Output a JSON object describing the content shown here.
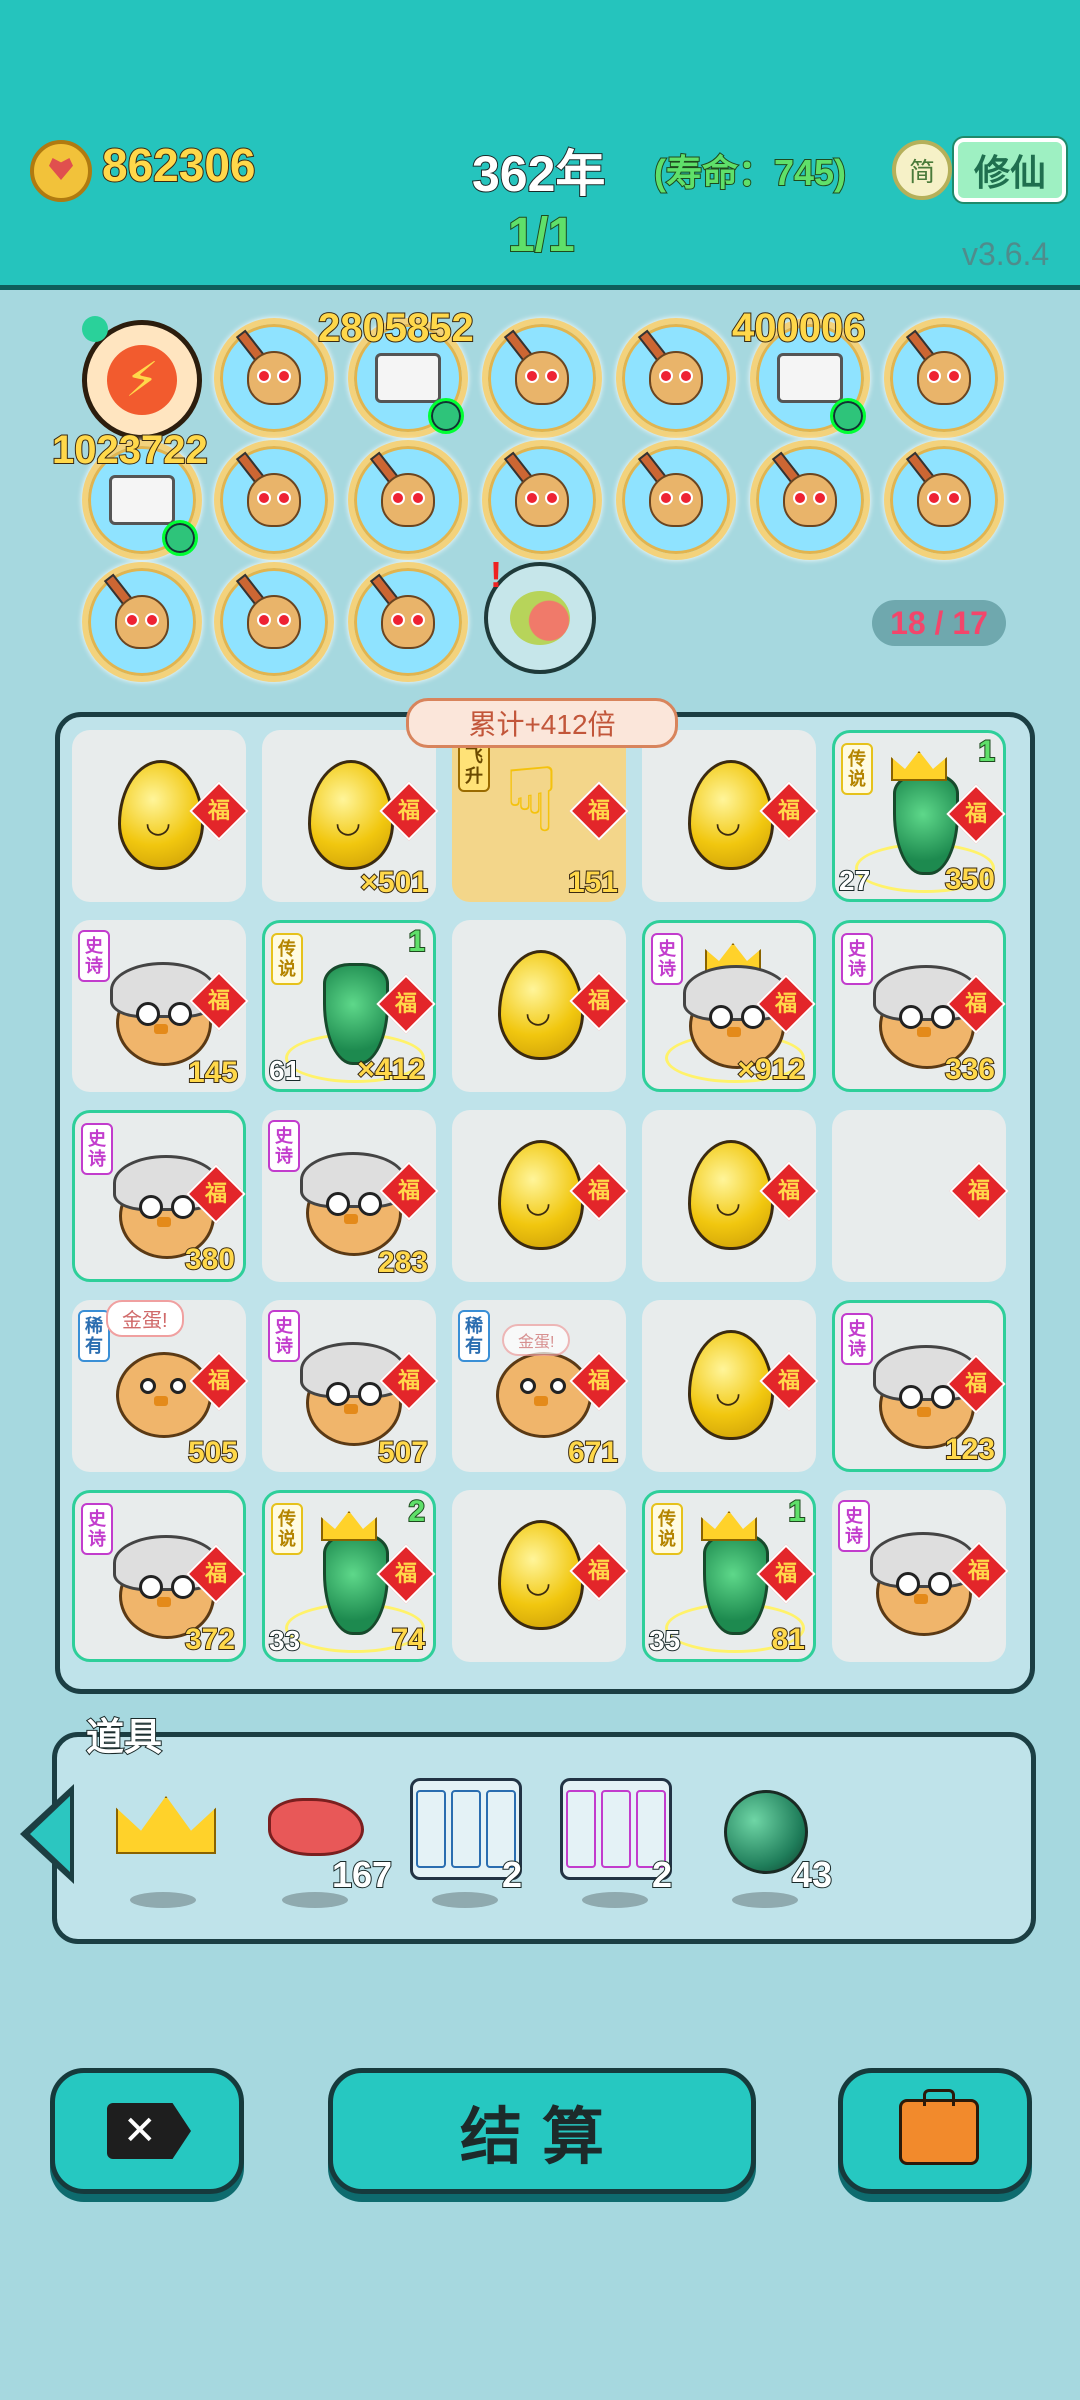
{
  "header": {
    "coins": "862306",
    "year": "362年",
    "lifespan": "(寿命：745)",
    "progress": "1/1",
    "simplified_label": "简",
    "cultivate_button": "修仙",
    "version": "v3.6.4"
  },
  "skills": {
    "lightning_value": "1023722",
    "pills_value_1": "2805852",
    "pills_value_2": "400006",
    "counter": "18 / 17"
  },
  "board": {
    "banner": "累计+412倍",
    "fu": "福",
    "tags": {
      "epic": "史诗",
      "legendary": "传说",
      "rare": "稀有",
      "ascend": "飞升"
    },
    "bubble_golden_egg": "金蛋!",
    "bubble_small": "金蛋!",
    "cells": [
      {
        "r": 0,
        "c": 0,
        "kind": "egg",
        "br": ""
      },
      {
        "r": 0,
        "c": 1,
        "kind": "egg",
        "br": "×501"
      },
      {
        "r": 0,
        "c": 2,
        "kind": "hand",
        "br": "151"
      },
      {
        "r": 0,
        "c": 3,
        "kind": "egg",
        "br": ""
      },
      {
        "r": 0,
        "c": 4,
        "kind": "vase",
        "br": "350",
        "bl": "27",
        "tr": "1"
      },
      {
        "r": 1,
        "c": 0,
        "kind": "chick",
        "br": "145"
      },
      {
        "r": 1,
        "c": 1,
        "kind": "vase",
        "br": "×412",
        "bl": "61",
        "tr": "1"
      },
      {
        "r": 1,
        "c": 2,
        "kind": "egg",
        "br": ""
      },
      {
        "r": 1,
        "c": 3,
        "kind": "chick",
        "br": "×912"
      },
      {
        "r": 1,
        "c": 4,
        "kind": "chick",
        "br": "336"
      },
      {
        "r": 2,
        "c": 0,
        "kind": "chick",
        "br": "380"
      },
      {
        "r": 2,
        "c": 1,
        "kind": "chick",
        "br": "283"
      },
      {
        "r": 2,
        "c": 2,
        "kind": "egg",
        "br": ""
      },
      {
        "r": 2,
        "c": 3,
        "kind": "egg",
        "br": ""
      },
      {
        "r": 2,
        "c": 4,
        "kind": "empty",
        "br": ""
      },
      {
        "r": 3,
        "c": 0,
        "kind": "chick-plain",
        "br": "505"
      },
      {
        "r": 3,
        "c": 1,
        "kind": "chick",
        "br": "507"
      },
      {
        "r": 3,
        "c": 2,
        "kind": "chick-plain",
        "br": "671"
      },
      {
        "r": 3,
        "c": 3,
        "kind": "egg",
        "br": ""
      },
      {
        "r": 3,
        "c": 4,
        "kind": "chick",
        "br": "123"
      },
      {
        "r": 4,
        "c": 0,
        "kind": "chick",
        "br": "372"
      },
      {
        "r": 4,
        "c": 1,
        "kind": "vase",
        "br": "74",
        "bl": "33",
        "tr": "2"
      },
      {
        "r": 4,
        "c": 2,
        "kind": "egg",
        "br": ""
      },
      {
        "r": 4,
        "c": 3,
        "kind": "vase",
        "br": "81",
        "bl": "35",
        "tr": "1"
      },
      {
        "r": 4,
        "c": 4,
        "kind": "chick",
        "br": ""
      }
    ]
  },
  "items": {
    "title": "道具",
    "liver_count": "167",
    "cards_rare_count": "2",
    "cards_epic_count": "2",
    "orb_count": "43"
  },
  "footer": {
    "settle_button": "结算"
  }
}
